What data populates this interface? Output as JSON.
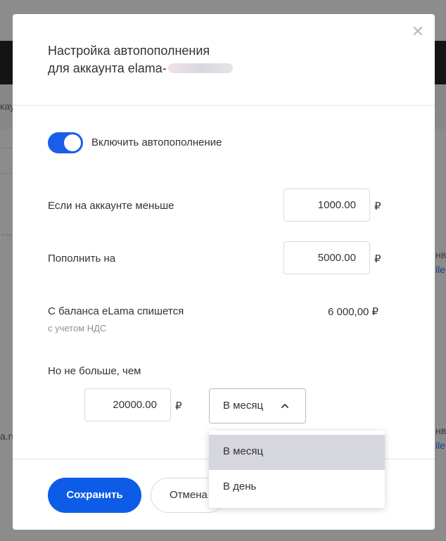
{
  "background": {
    "fragment_left_1": "кау",
    "fragment_left_2": "a.ru",
    "fragment_dots": "•••",
    "fragment_right_1": "нв",
    "fragment_right_link_1": "ile",
    "fragment_right_2": "нв",
    "fragment_right_link_2": "ile"
  },
  "modal": {
    "title_line1": "Настройка автопополнения",
    "title_line2": "для аккаунта elama-",
    "close_icon": "✕",
    "toggle": {
      "label": "Включить автопополнение",
      "checked": true
    },
    "threshold": {
      "label": "Если на аккаунте меньше",
      "value": "1000.00",
      "currency": "₽"
    },
    "topup": {
      "label": "Пополнить на",
      "value": "5000.00",
      "currency": "₽"
    },
    "charge": {
      "label": "С баланса eLama спишется",
      "note": "с учетом НДС",
      "amount": "6 000,00 ₽"
    },
    "limit": {
      "label": "Но не больше, чем",
      "value": "20000.00",
      "currency": "₽"
    },
    "period": {
      "selected": "В месяц",
      "options": [
        "В месяц",
        "В день"
      ],
      "highlighted": "В месяц",
      "open": true
    },
    "save_label": "Сохранить",
    "cancel_label": "Отмена"
  },
  "colors": {
    "accent": "#0d5ce8",
    "dropdown_highlight": "#d6d7de",
    "muted_text": "#8e9099"
  }
}
